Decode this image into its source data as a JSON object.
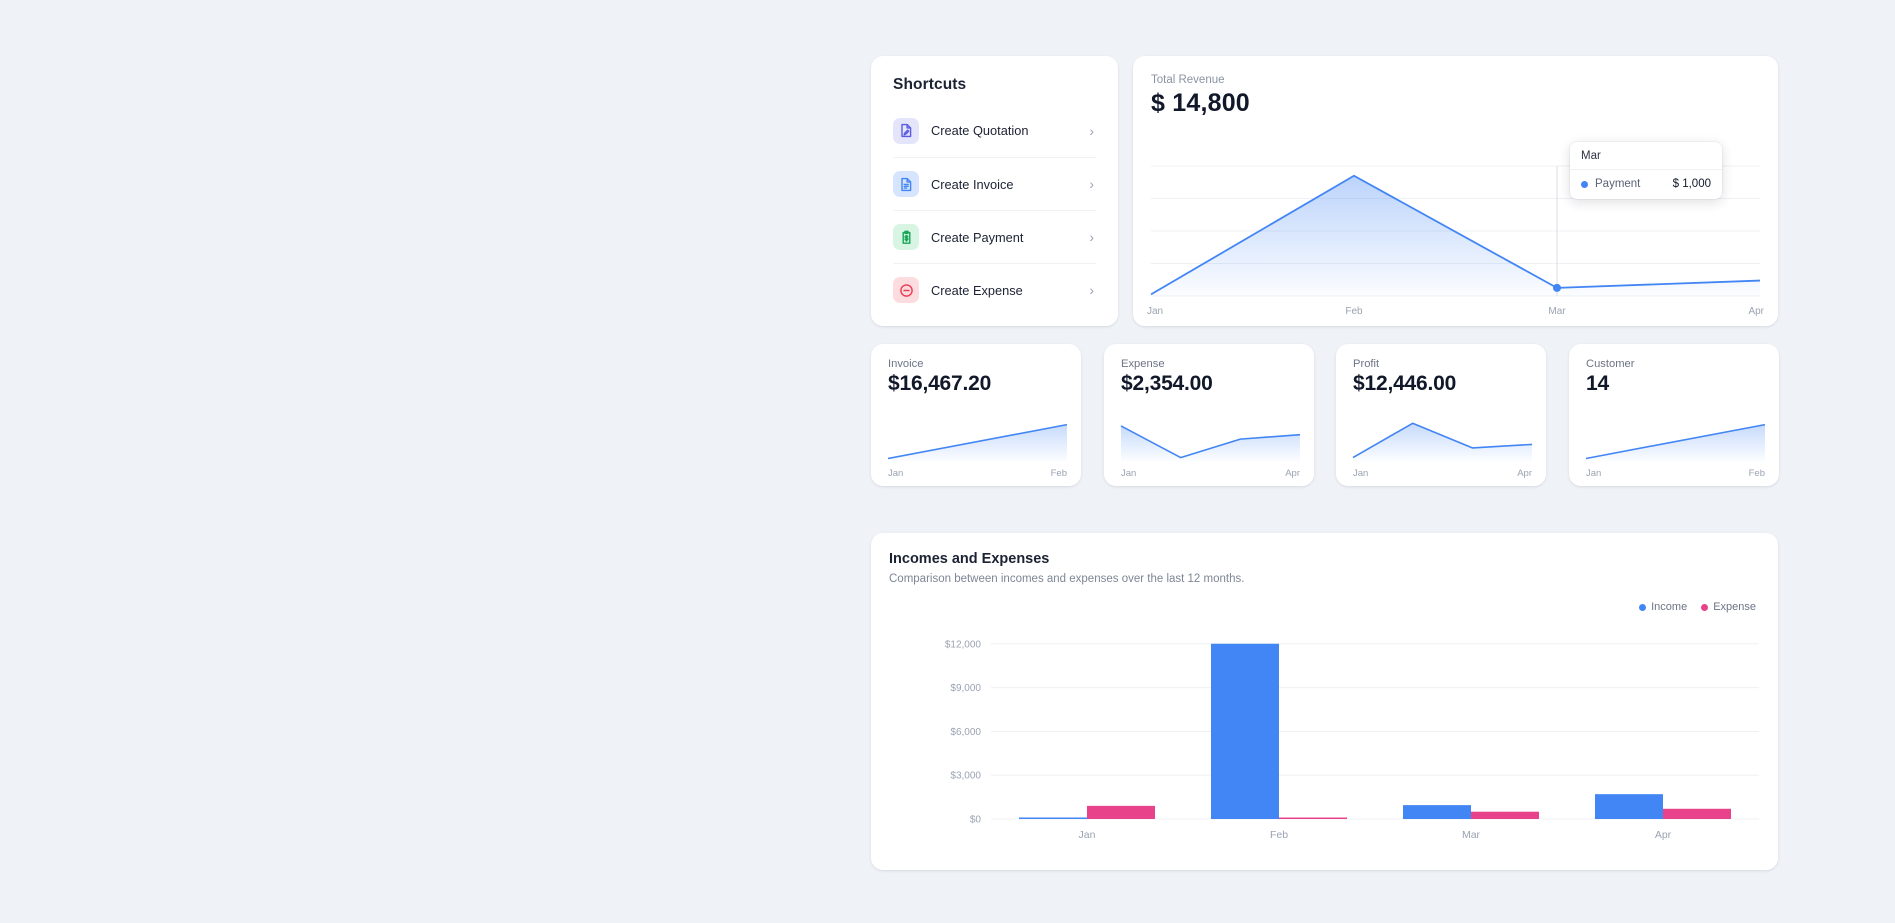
{
  "theme": {
    "page_bg": "#eff2f7",
    "card_bg": "#ffffff",
    "accent_blue": "#4285f4",
    "accent_pink": "#e8438a",
    "text_dark": "#11182a",
    "text_muted": "#8b93a3"
  },
  "shortcuts": {
    "title": "Shortcuts",
    "items": [
      {
        "label": "Create Quotation",
        "icon": "document-edit-icon",
        "icon_color": "#5b5ce2",
        "icon_bg": "#e4e4fb",
        "chevron": "›"
      },
      {
        "label": "Create Invoice",
        "icon": "document-lines-icon",
        "icon_color": "#4285f4",
        "icon_bg": "#d6e4fd",
        "chevron": "›"
      },
      {
        "label": "Create Payment",
        "icon": "clipboard-dollar-icon",
        "icon_color": "#18a558",
        "icon_bg": "#d8f5e3",
        "chevron": "›"
      },
      {
        "label": "Create Expense",
        "icon": "circle-minus-icon",
        "icon_color": "#ee3b52",
        "icon_bg": "#fcdcdf",
        "chevron": "›"
      }
    ]
  },
  "revenue": {
    "label": "Total Revenue",
    "value": "$ 14,800",
    "tooltip": {
      "header": "Mar",
      "series_name": "Payment",
      "series_value": "$ 1,000",
      "dot_color": "#4285f4"
    },
    "chart_data": {
      "type": "area",
      "title": "Total Revenue",
      "categories": [
        "Jan",
        "Feb",
        "Mar",
        "Apr"
      ],
      "values": [
        200,
        14800,
        1000,
        1900
      ],
      "series": [
        {
          "name": "Payment",
          "values": [
            200,
            14800,
            1000,
            1900
          ]
        }
      ],
      "xlabel": "",
      "ylabel": "",
      "ylim": [
        0,
        16000
      ],
      "grid": true,
      "legend": "none",
      "line_color": "#4285f4",
      "highlight_point": {
        "category": "Mar",
        "value": 1000
      }
    }
  },
  "kpis": [
    {
      "label": "Invoice",
      "value": "$16,467.20",
      "axis_start": "Jan",
      "axis_end": "Feb",
      "chart_data": {
        "type": "area",
        "categories": [
          "Jan",
          "Feb"
        ],
        "values": [
          8,
          85
        ],
        "ylim": [
          0,
          100
        ],
        "line_color": "#4285f4"
      }
    },
    {
      "label": "Expense",
      "value": "$2,354.00",
      "axis_start": "Jan",
      "axis_end": "Apr",
      "chart_data": {
        "type": "area",
        "categories": [
          "Jan",
          "Feb",
          "Mar",
          "Apr"
        ],
        "values": [
          82,
          10,
          52,
          62
        ],
        "ylim": [
          0,
          100
        ],
        "line_color": "#4285f4"
      }
    },
    {
      "label": "Profit",
      "value": "$12,446.00",
      "axis_start": "Jan",
      "axis_end": "Apr",
      "chart_data": {
        "type": "area",
        "categories": [
          "Jan",
          "Feb",
          "Mar",
          "Apr"
        ],
        "values": [
          10,
          88,
          32,
          40
        ],
        "ylim": [
          0,
          100
        ],
        "line_color": "#4285f4"
      }
    },
    {
      "label": "Customer",
      "value": "14",
      "axis_start": "Jan",
      "axis_end": "Feb",
      "chart_data": {
        "type": "area",
        "categories": [
          "Jan",
          "Feb"
        ],
        "values": [
          8,
          85
        ],
        "ylim": [
          0,
          100
        ],
        "line_color": "#4285f4"
      }
    }
  ],
  "bars": {
    "title": "Incomes and Expenses",
    "subtitle": "Comparison between incomes and expenses over the last 12 months.",
    "legend": [
      {
        "label": "Income",
        "color": "#4285f4"
      },
      {
        "label": "Expense",
        "color": "#e8438a"
      }
    ],
    "chart_data": {
      "type": "bar",
      "title": "Incomes and Expenses",
      "subtitle": "Comparison between incomes and expenses over the last 12 months.",
      "categories": [
        "Jan",
        "Feb",
        "Mar",
        "Apr"
      ],
      "series": [
        {
          "name": "Income",
          "color": "#4285f4",
          "values": [
            100,
            12000,
            950,
            1700
          ]
        },
        {
          "name": "Expense",
          "color": "#e8438a",
          "values": [
            900,
            30,
            500,
            700
          ]
        }
      ],
      "ytick_labels": [
        "$0",
        "$3,000",
        "$6,000",
        "$9,000",
        "$12,000"
      ],
      "ytick_values": [
        0,
        3000,
        6000,
        9000,
        12000
      ],
      "ylim": [
        0,
        12600
      ],
      "xlabel": "",
      "ylabel": "",
      "grid": true,
      "legend": "top-right"
    }
  }
}
